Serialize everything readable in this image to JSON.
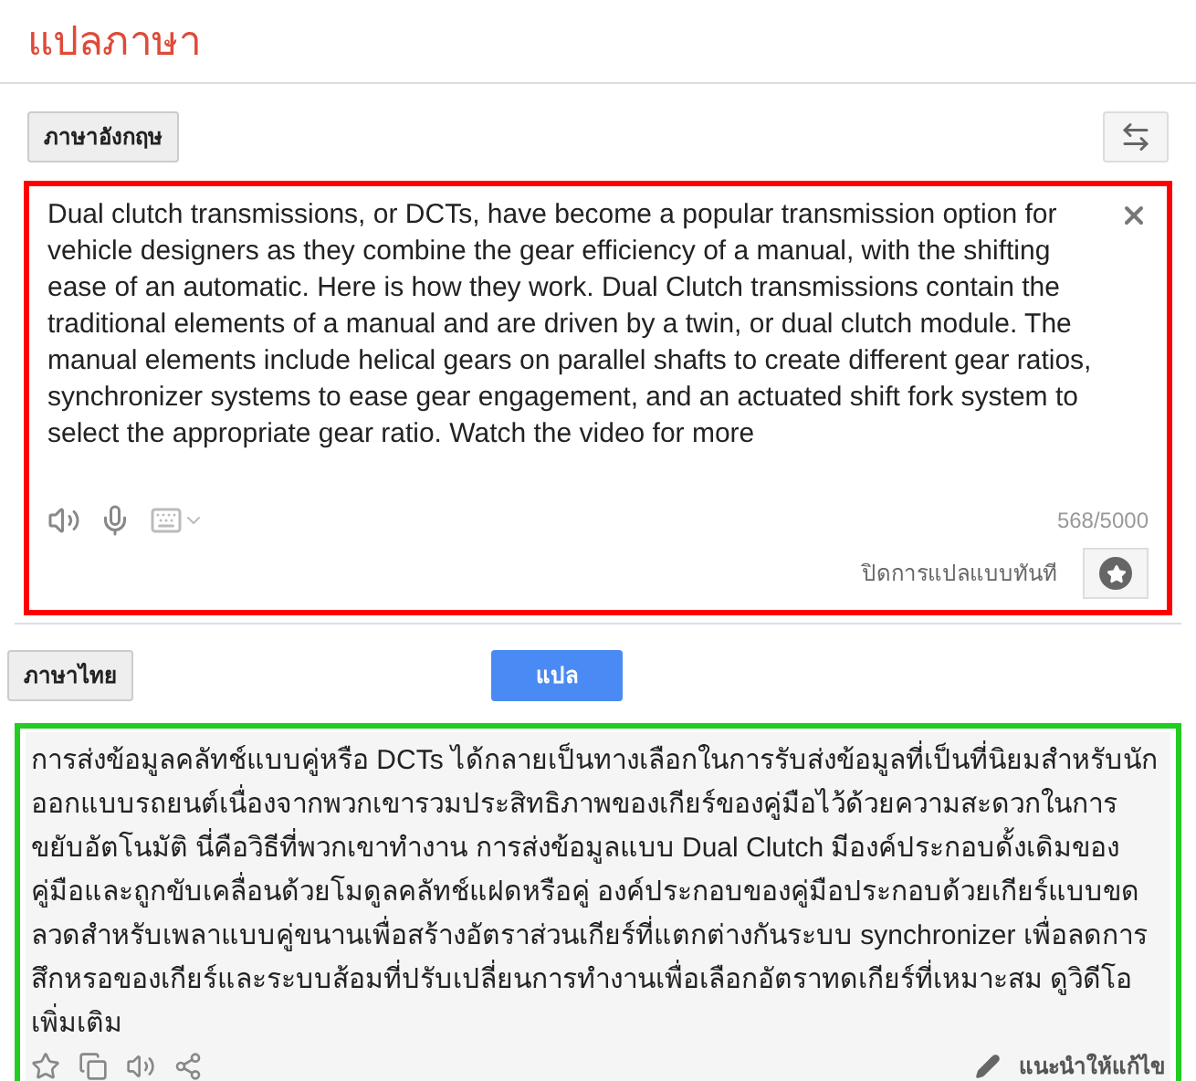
{
  "header": {
    "title": "แปลภาษา"
  },
  "source": {
    "language": "ภาษาอังกฤษ",
    "text": "Dual clutch transmissions, or DCTs, have become a popular transmission option for vehicle designers as they combine the gear efficiency of a manual, with the shifting ease of an automatic. Here is how they work. Dual Clutch transmissions contain the traditional elements of a manual and are driven by a twin, or dual clutch module. The manual elements include helical gears on parallel shafts to create different gear ratios, synchronizer systems to ease gear engagement, and an actuated shift fork system to select the appropriate gear ratio. Watch the video for more",
    "count": "568/5000",
    "instant_toggle": "ปิดการแปลแบบทันที"
  },
  "target": {
    "language": "ภาษาไทย",
    "translate_button": "แปล",
    "text": "การส่งข้อมูลคลัทช์แบบคู่หรือ DCTs ได้กลายเป็นทางเลือกในการรับส่งข้อมูลที่เป็นที่นิยมสำหรับนักออกแบบรถยนต์เนื่องจากพวกเขารวมประสิทธิภาพของเกียร์ของคู่มือไว้ด้วยความสะดวกในการขยับอัตโนมัติ นี่คือวิธีที่พวกเขาทำงาน การส่งข้อมูลแบบ Dual Clutch มีองค์ประกอบดั้งเดิมของคู่มือและถูกขับเคลื่อนด้วยโมดูลคลัทช์แฝดหรือคู่ องค์ประกอบของคู่มือประกอบด้วยเกียร์แบบขดลวดสำหรับเพลาแบบคู่ขนานเพื่อสร้างอัตราส่วนเกียร์ที่แตกต่างกันระบบ synchronizer เพื่อลดการสึกหรอของเกียร์และระบบส้อมที่ปรับเปลี่ยนการทำงานเพื่อเลือกอัตราทดเกียร์ที่เหมาะสม ดูวิดีโอเพิ่มเติม",
    "suggest_edit": "แนะนำให้แก้ไข"
  }
}
